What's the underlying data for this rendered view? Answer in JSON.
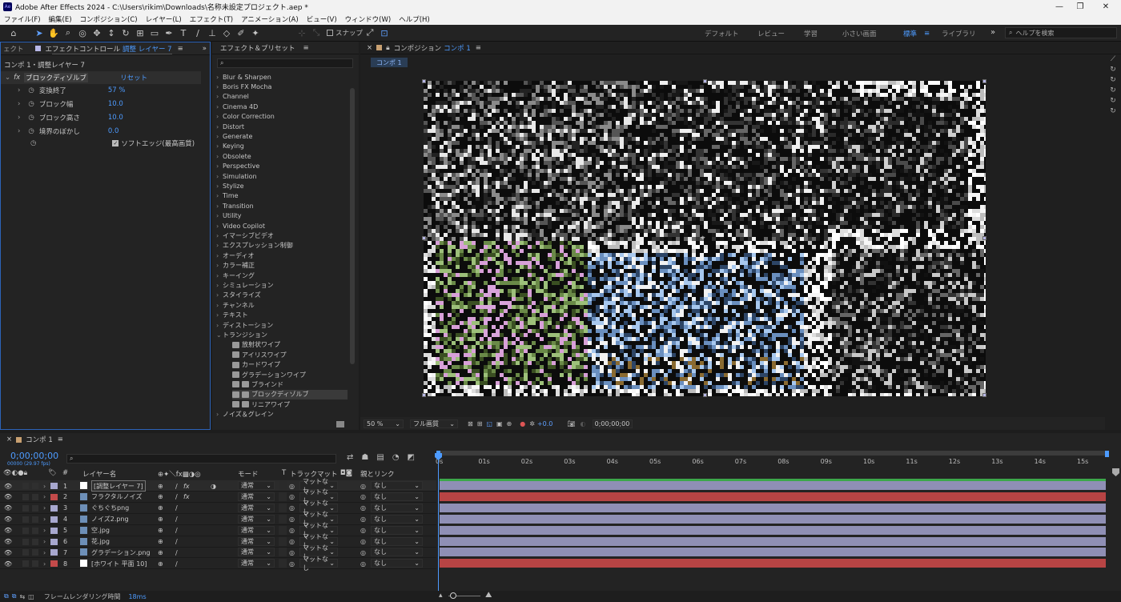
{
  "window": {
    "title": "Adobe After Effects 2024 - C:\\Users\\rikim\\Downloads\\名称未設定プロジェクト.aep *",
    "app_icon": "Ae",
    "controls": [
      "minimize-icon",
      "maximize-icon",
      "close-icon"
    ]
  },
  "menu": [
    "ファイル(F)",
    "編集(E)",
    "コンポジション(C)",
    "レイヤー(L)",
    "エフェクト(T)",
    "アニメーション(A)",
    "ビュー(V)",
    "ウィンドウ(W)",
    "ヘルプ(H)"
  ],
  "toolbar": {
    "snap_label": "スナップ",
    "workspaces": [
      "デフォルト",
      "レビュー",
      "学習",
      "小さい画面",
      "標準",
      "ライブラリ"
    ],
    "active_workspace": "標準",
    "search_placeholder": "ヘルプを検索"
  },
  "effect_controls": {
    "tab_prefix": "ェクト",
    "title": "エフェクトコントロール",
    "title_target": "調整 レイヤー 7",
    "breadcrumb": "コンポ 1・調整レイヤー 7",
    "effect_name": "ブロックディゾルブ",
    "reset": "リセット",
    "props": [
      {
        "label": "変換終了",
        "value": "57 %"
      },
      {
        "label": "ブロック幅",
        "value": "10.0"
      },
      {
        "label": "ブロック高さ",
        "value": "10.0"
      },
      {
        "label": "境界のぼかし",
        "value": "0.0"
      }
    ],
    "checkbox_label": "ソフトエッジ(最高画質)"
  },
  "effects_presets": {
    "title": "エフェクト＆プリセット",
    "search_placeholder": "",
    "categories": [
      "Blur & Sharpen",
      "Boris FX Mocha",
      "Channel",
      "Cinema 4D",
      "Color Correction",
      "Distort",
      "Generate",
      "Keying",
      "Obsolete",
      "Perspective",
      "Simulation",
      "Stylize",
      "Time",
      "Transition",
      "Utility",
      "Video Copilot",
      "イマーシブビデオ",
      "エクスプレッション制御",
      "オーディオ",
      "カラー補正",
      "キーイング",
      "シミュレーション",
      "スタイライズ",
      "チャンネル",
      "テキスト",
      "ディストーション"
    ],
    "open_category": "トランジション",
    "sub_items": [
      "放射状ワイプ",
      "アイリスワイプ",
      "カードワイプ",
      "グラデーションワイプ",
      "ブラインド",
      "ブロックディゾルブ",
      "リニアワイプ"
    ],
    "selected_sub": "ブロックディゾルブ",
    "after": "ノイズ＆グレイン"
  },
  "composition": {
    "tab_label": "コンポジション",
    "comp_name": "コンポ 1",
    "sub_tab": "コンポ 1",
    "zoom": "50 %",
    "resolution": "フル画質",
    "exposure": "+0.0",
    "timecode": "0;00;00;00"
  },
  "timeline": {
    "tab": "コンポ 1",
    "timecode": "0;00;00;00",
    "fps": "00000 (29.97 fps)",
    "search_placeholder": "",
    "headers": {
      "layer_name": "レイヤー名",
      "mode": "モード",
      "trackmatte": "トラックマット",
      "parent": "親とリンク",
      "t": "T"
    },
    "ruler": [
      "0s",
      "01s",
      "02s",
      "03s",
      "04s",
      "05s",
      "06s",
      "07s",
      "08s",
      "09s",
      "10s",
      "11s",
      "12s",
      "13s",
      "14s",
      "15s"
    ],
    "layers": [
      {
        "num": "1",
        "name": "[調整レイヤー 7]",
        "color": "#a8a8cf",
        "mode": "通常",
        "matte": "マットなし",
        "parent": "なし",
        "fx": "fx",
        "bar": "#8f8fb5"
      },
      {
        "num": "2",
        "name": "フラクタルノイズ",
        "color": "#c34a4a",
        "mode": "通常",
        "matte": "マットなし",
        "parent": "なし",
        "fx": "fx",
        "bar": "#b74444"
      },
      {
        "num": "3",
        "name": "ぐちぐちpng",
        "color": "#a8a8cf",
        "mode": "通常",
        "matte": "マットなし",
        "parent": "なし",
        "fx": "",
        "bar": "#8f8fb5"
      },
      {
        "num": "4",
        "name": "ノイズ2.png",
        "color": "#a8a8cf",
        "mode": "通常",
        "matte": "マットなし",
        "parent": "なし",
        "fx": "",
        "bar": "#8f8fb5"
      },
      {
        "num": "5",
        "name": "空.jpg",
        "color": "#a8a8cf",
        "mode": "通常",
        "matte": "マットなし",
        "parent": "なし",
        "fx": "",
        "bar": "#8f8fb5"
      },
      {
        "num": "6",
        "name": "花.jpg",
        "color": "#a8a8cf",
        "mode": "通常",
        "matte": "マットなし",
        "parent": "なし",
        "fx": "",
        "bar": "#8f8fb5"
      },
      {
        "num": "7",
        "name": "グラデーション.png",
        "color": "#a8a8cf",
        "mode": "通常",
        "matte": "マットなし",
        "parent": "なし",
        "fx": "",
        "bar": "#8f8fb5"
      },
      {
        "num": "8",
        "name": "[ホワイト 平面 10]",
        "color": "#c34a4a",
        "mode": "通常",
        "matte": "マットなし",
        "parent": "なし",
        "fx": "",
        "bar": "#b74444"
      }
    ],
    "render_label": "フレームレンダリング時間",
    "render_value": "18ms"
  }
}
